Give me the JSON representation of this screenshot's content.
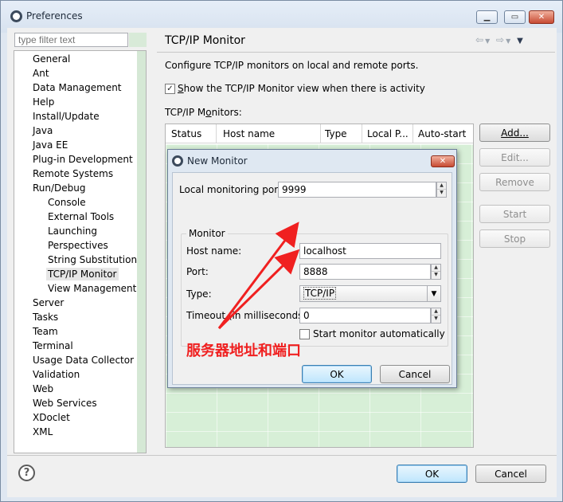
{
  "window": {
    "title": "Preferences",
    "controls": [
      "minimize",
      "maximize",
      "close"
    ]
  },
  "sidebar": {
    "filter_placeholder": "type filter text",
    "items": [
      {
        "label": "General",
        "level": 0
      },
      {
        "label": "Ant",
        "level": 0
      },
      {
        "label": "Data Management",
        "level": 0
      },
      {
        "label": "Help",
        "level": 0
      },
      {
        "label": "Install/Update",
        "level": 0
      },
      {
        "label": "Java",
        "level": 0
      },
      {
        "label": "Java EE",
        "level": 0
      },
      {
        "label": "Plug-in Development",
        "level": 0
      },
      {
        "label": "Remote Systems",
        "level": 0
      },
      {
        "label": "Run/Debug",
        "level": 0
      },
      {
        "label": "Console",
        "level": 1
      },
      {
        "label": "External Tools",
        "level": 1
      },
      {
        "label": "Launching",
        "level": 1
      },
      {
        "label": "Perspectives",
        "level": 1
      },
      {
        "label": "String Substitution",
        "level": 1
      },
      {
        "label": "TCP/IP Monitor",
        "level": 1,
        "selected": true
      },
      {
        "label": "View Management",
        "level": 1
      },
      {
        "label": "Server",
        "level": 0
      },
      {
        "label": "Tasks",
        "level": 0
      },
      {
        "label": "Team",
        "level": 0
      },
      {
        "label": "Terminal",
        "level": 0
      },
      {
        "label": "Usage Data Collector",
        "level": 0
      },
      {
        "label": "Validation",
        "level": 0
      },
      {
        "label": "Web",
        "level": 0
      },
      {
        "label": "Web Services",
        "level": 0
      },
      {
        "label": "XDoclet",
        "level": 0
      },
      {
        "label": "XML",
        "level": 0
      }
    ]
  },
  "page": {
    "title": "TCP/IP Monitor",
    "description": "Configure TCP/IP monitors on local and remote ports.",
    "show_view_checkbox": {
      "label_prefix": "S",
      "label_rest": "how the TCP/IP Monitor view when there is activity",
      "checked": true
    },
    "monitors_label_prefix": "TCP/IP M",
    "monitors_label_u": "o",
    "monitors_label_rest": "nitors:",
    "table_columns": [
      "Status",
      "Host name",
      "Type",
      "Local P...",
      "Auto-start"
    ],
    "buttons": {
      "add": "Add...",
      "edit": "Edit...",
      "remove": "Remove",
      "start": "Start",
      "stop": "Stop"
    }
  },
  "footer": {
    "help_icon": "?",
    "ok": "OK",
    "cancel": "Cancel"
  },
  "dialog": {
    "title": "New Monitor",
    "local_port_label": "Local monitoring port:",
    "local_port_value": "9999",
    "group_title": "Monitor",
    "host_label": "Host name:",
    "host_value": "localhost",
    "port_label": "Port:",
    "port_value": "8888",
    "type_label": "Type:",
    "type_value": "TCP/IP",
    "timeout_label": "Timeout (in milliseconds):",
    "timeout_value": "0",
    "start_auto_label": "Start monitor automatically",
    "start_auto_checked": false,
    "ok": "OK",
    "cancel": "Cancel"
  },
  "annotation": {
    "text": "服务器地址和端口",
    "color": "#f02020"
  }
}
